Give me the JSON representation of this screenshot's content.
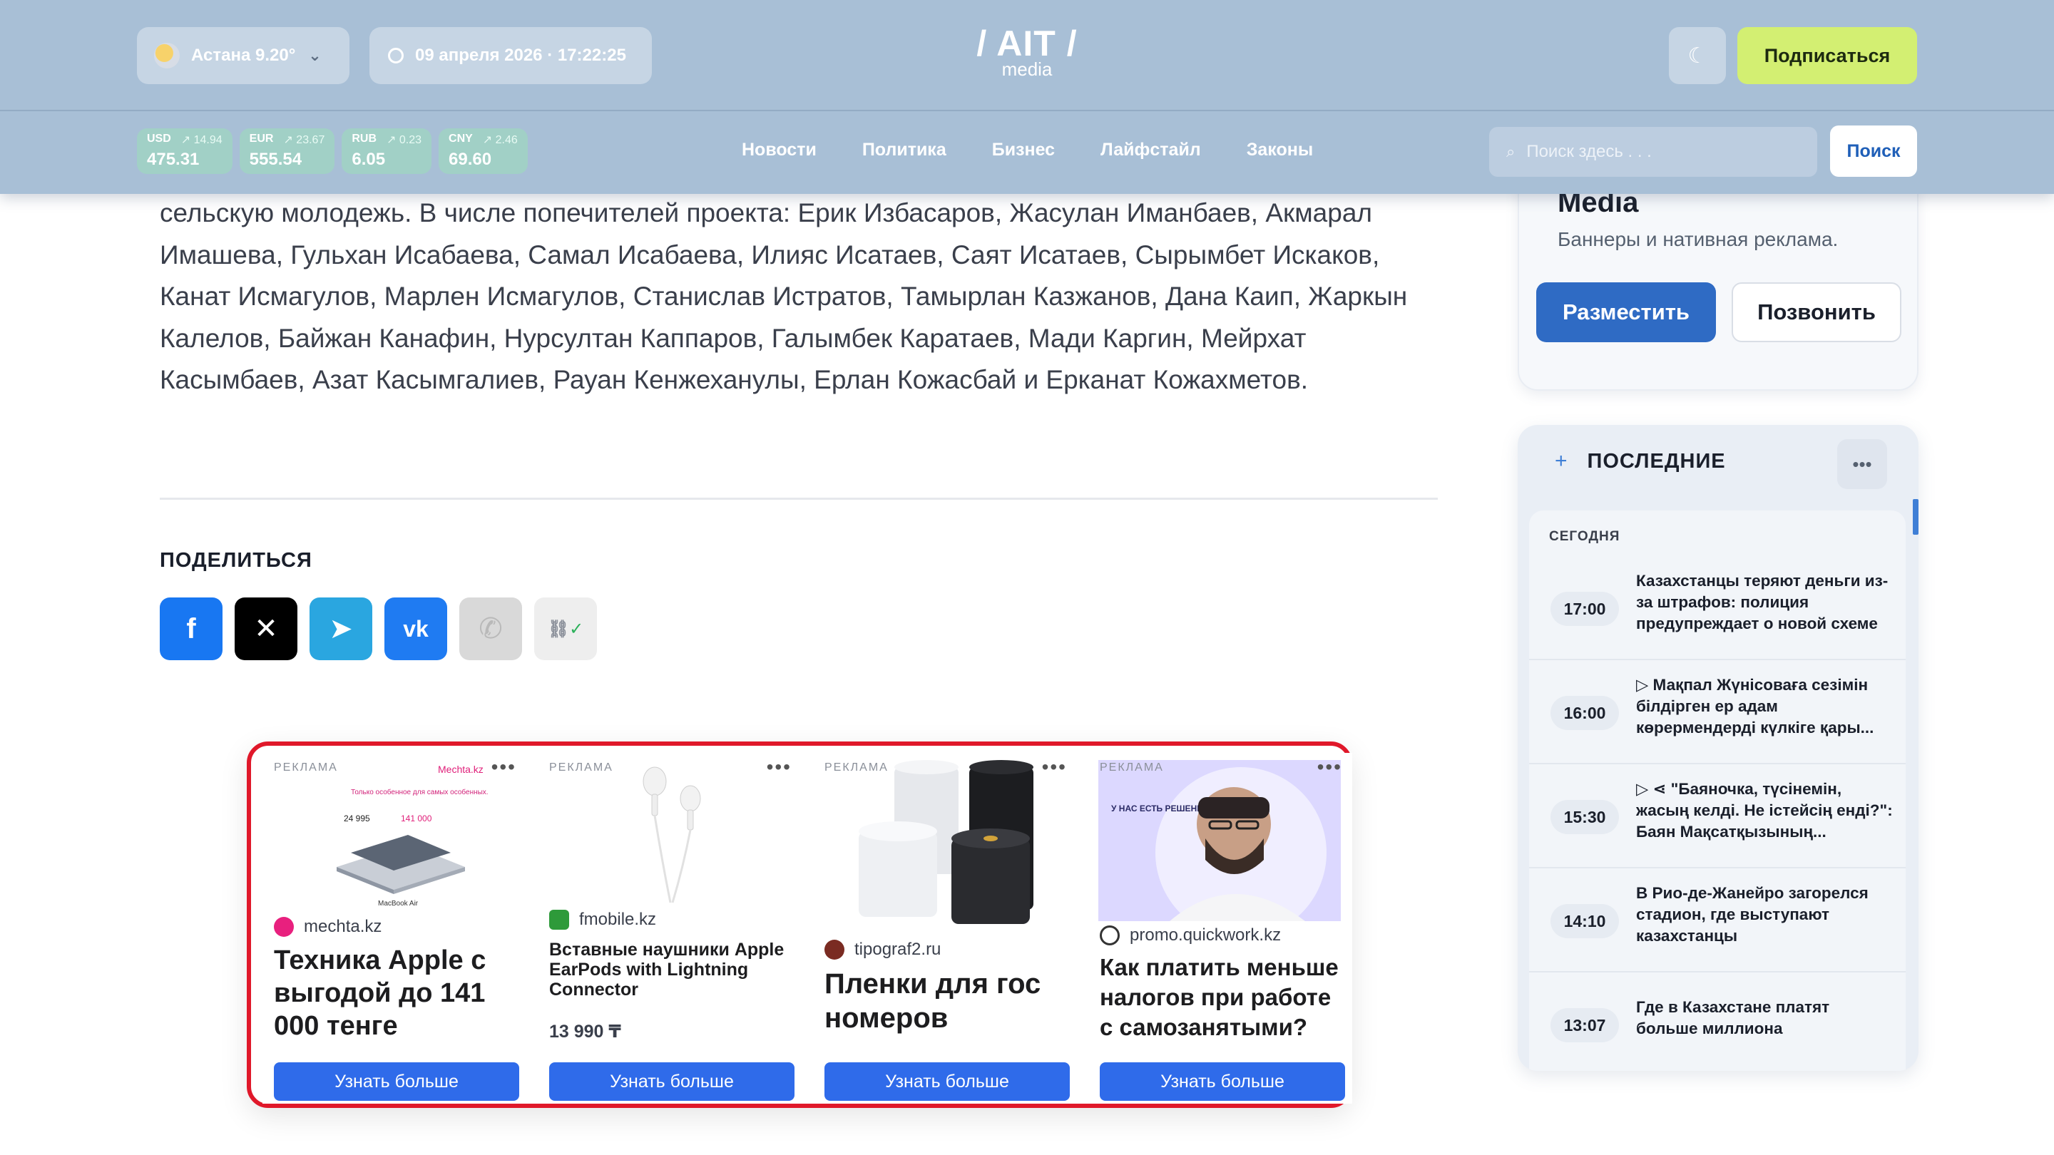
{
  "header": {
    "weather_text": "Астана 9.20°",
    "datetime": "09 апреля 2026 · 17:22:25",
    "logo_big": "/ AIT /",
    "logo_small": "media",
    "subscribe_label": "Подписаться",
    "rates": [
      {
        "code": "USD",
        "delta": "↗ 14.94",
        "value": "475.31"
      },
      {
        "code": "EUR",
        "delta": "↗ 23.67",
        "value": "555.54"
      },
      {
        "code": "RUB",
        "delta": "↗ 0.23",
        "value": "6.05"
      },
      {
        "code": "CNY",
        "delta": "↗ 2.46",
        "value": "69.60"
      }
    ],
    "nav": [
      "Новости",
      "Политика",
      "Бизнес",
      "Лайфстайл",
      "Законы"
    ],
    "search_placeholder": "Поиск здесь . . .",
    "search_button": "Поиск"
  },
  "article": {
    "text": "сельскую молодежь. В числе попечителей проекта: Ерик Избасаров, Жасулан Иманбаев, Акмарал Имашева, Гульхан Исабаева, Самал Исабаева, Илияс Исатаев, Саят Исатаев, Сырымбет Искаков, Канат Исмагулов, Марлен Исмагулов, Станислав Истратов, Тамырлан Казжанов, Дана Каип, Жаркын Калелов, Байжан Канафин, Нурсултан Каппаров, Галымбек Каратаев, Мади Каргин, Мейрхат Касымбаев, Азат Касымгалиев, Рауан Кенжеханулы, Ерлан Кожасбай и Ерканат Кожахметов.",
    "share_title": "ПОДЕЛИТЬСЯ"
  },
  "ads": [
    {
      "label": "РЕКЛАМА",
      "source": "mechta.kz",
      "headline": "Техника Apple с выгодой до 141 000 тенге",
      "price": "",
      "cta": "Узнать больше",
      "promo_brand": "Mechta.kz",
      "promo_line": "Только особенное для самых особенных.",
      "promo_old": "24 995",
      "promo_new": "141 000",
      "promo_footer": "MacBook Air"
    },
    {
      "label": "РЕКЛАМА",
      "source": "fmobile.kz",
      "headline": "Вставные наушники Apple EarPods with Lightning Connector",
      "price": "13 990 ₸",
      "cta": "Узнать больше"
    },
    {
      "label": "РЕКЛАМА",
      "source": "tipograf2.ru",
      "headline": "Пленки для гос номеров",
      "price": "",
      "cta": "Узнать больше"
    },
    {
      "label": "РЕКЛАМА",
      "source": "promo.quickwork.kz",
      "headline": "Как платить меньше налогов при работе с самозанятыми?",
      "price": "",
      "cta": "Узнать больше",
      "promo_line": "У НАС ЕСТЬ РЕШЕНИЕ"
    }
  ],
  "sidebar": {
    "ad_title": "Media",
    "ad_desc": "Баннеры и нативная реклама.",
    "place_label": "Разместить",
    "call_label": "Позвонить",
    "latest_title": "ПОСЛЕДНИЕ",
    "today_label": "СЕГОДНЯ",
    "news": [
      {
        "time": "17:00",
        "text": "Казахстанцы теряют деньги из-за штрафов: полиция предупреждает о новой схеме"
      },
      {
        "time": "16:00",
        "text": "▷ Мақпал Жүнісоваға сезімін білдірген ер адам көрермендерді күлкіге қары..."
      },
      {
        "time": "15:30",
        "text": "▷ ⋖ \"Баяночка, түсінемін, жасың келді. Не істейсің енді?\": Баян Мақсатқызының..."
      },
      {
        "time": "14:10",
        "text": "В Рио-де-Жанейро загорелся стадион, где выступают казахстанцы"
      },
      {
        "time": "13:07",
        "text": "Где в Казахстане платят больше миллиона"
      }
    ]
  }
}
